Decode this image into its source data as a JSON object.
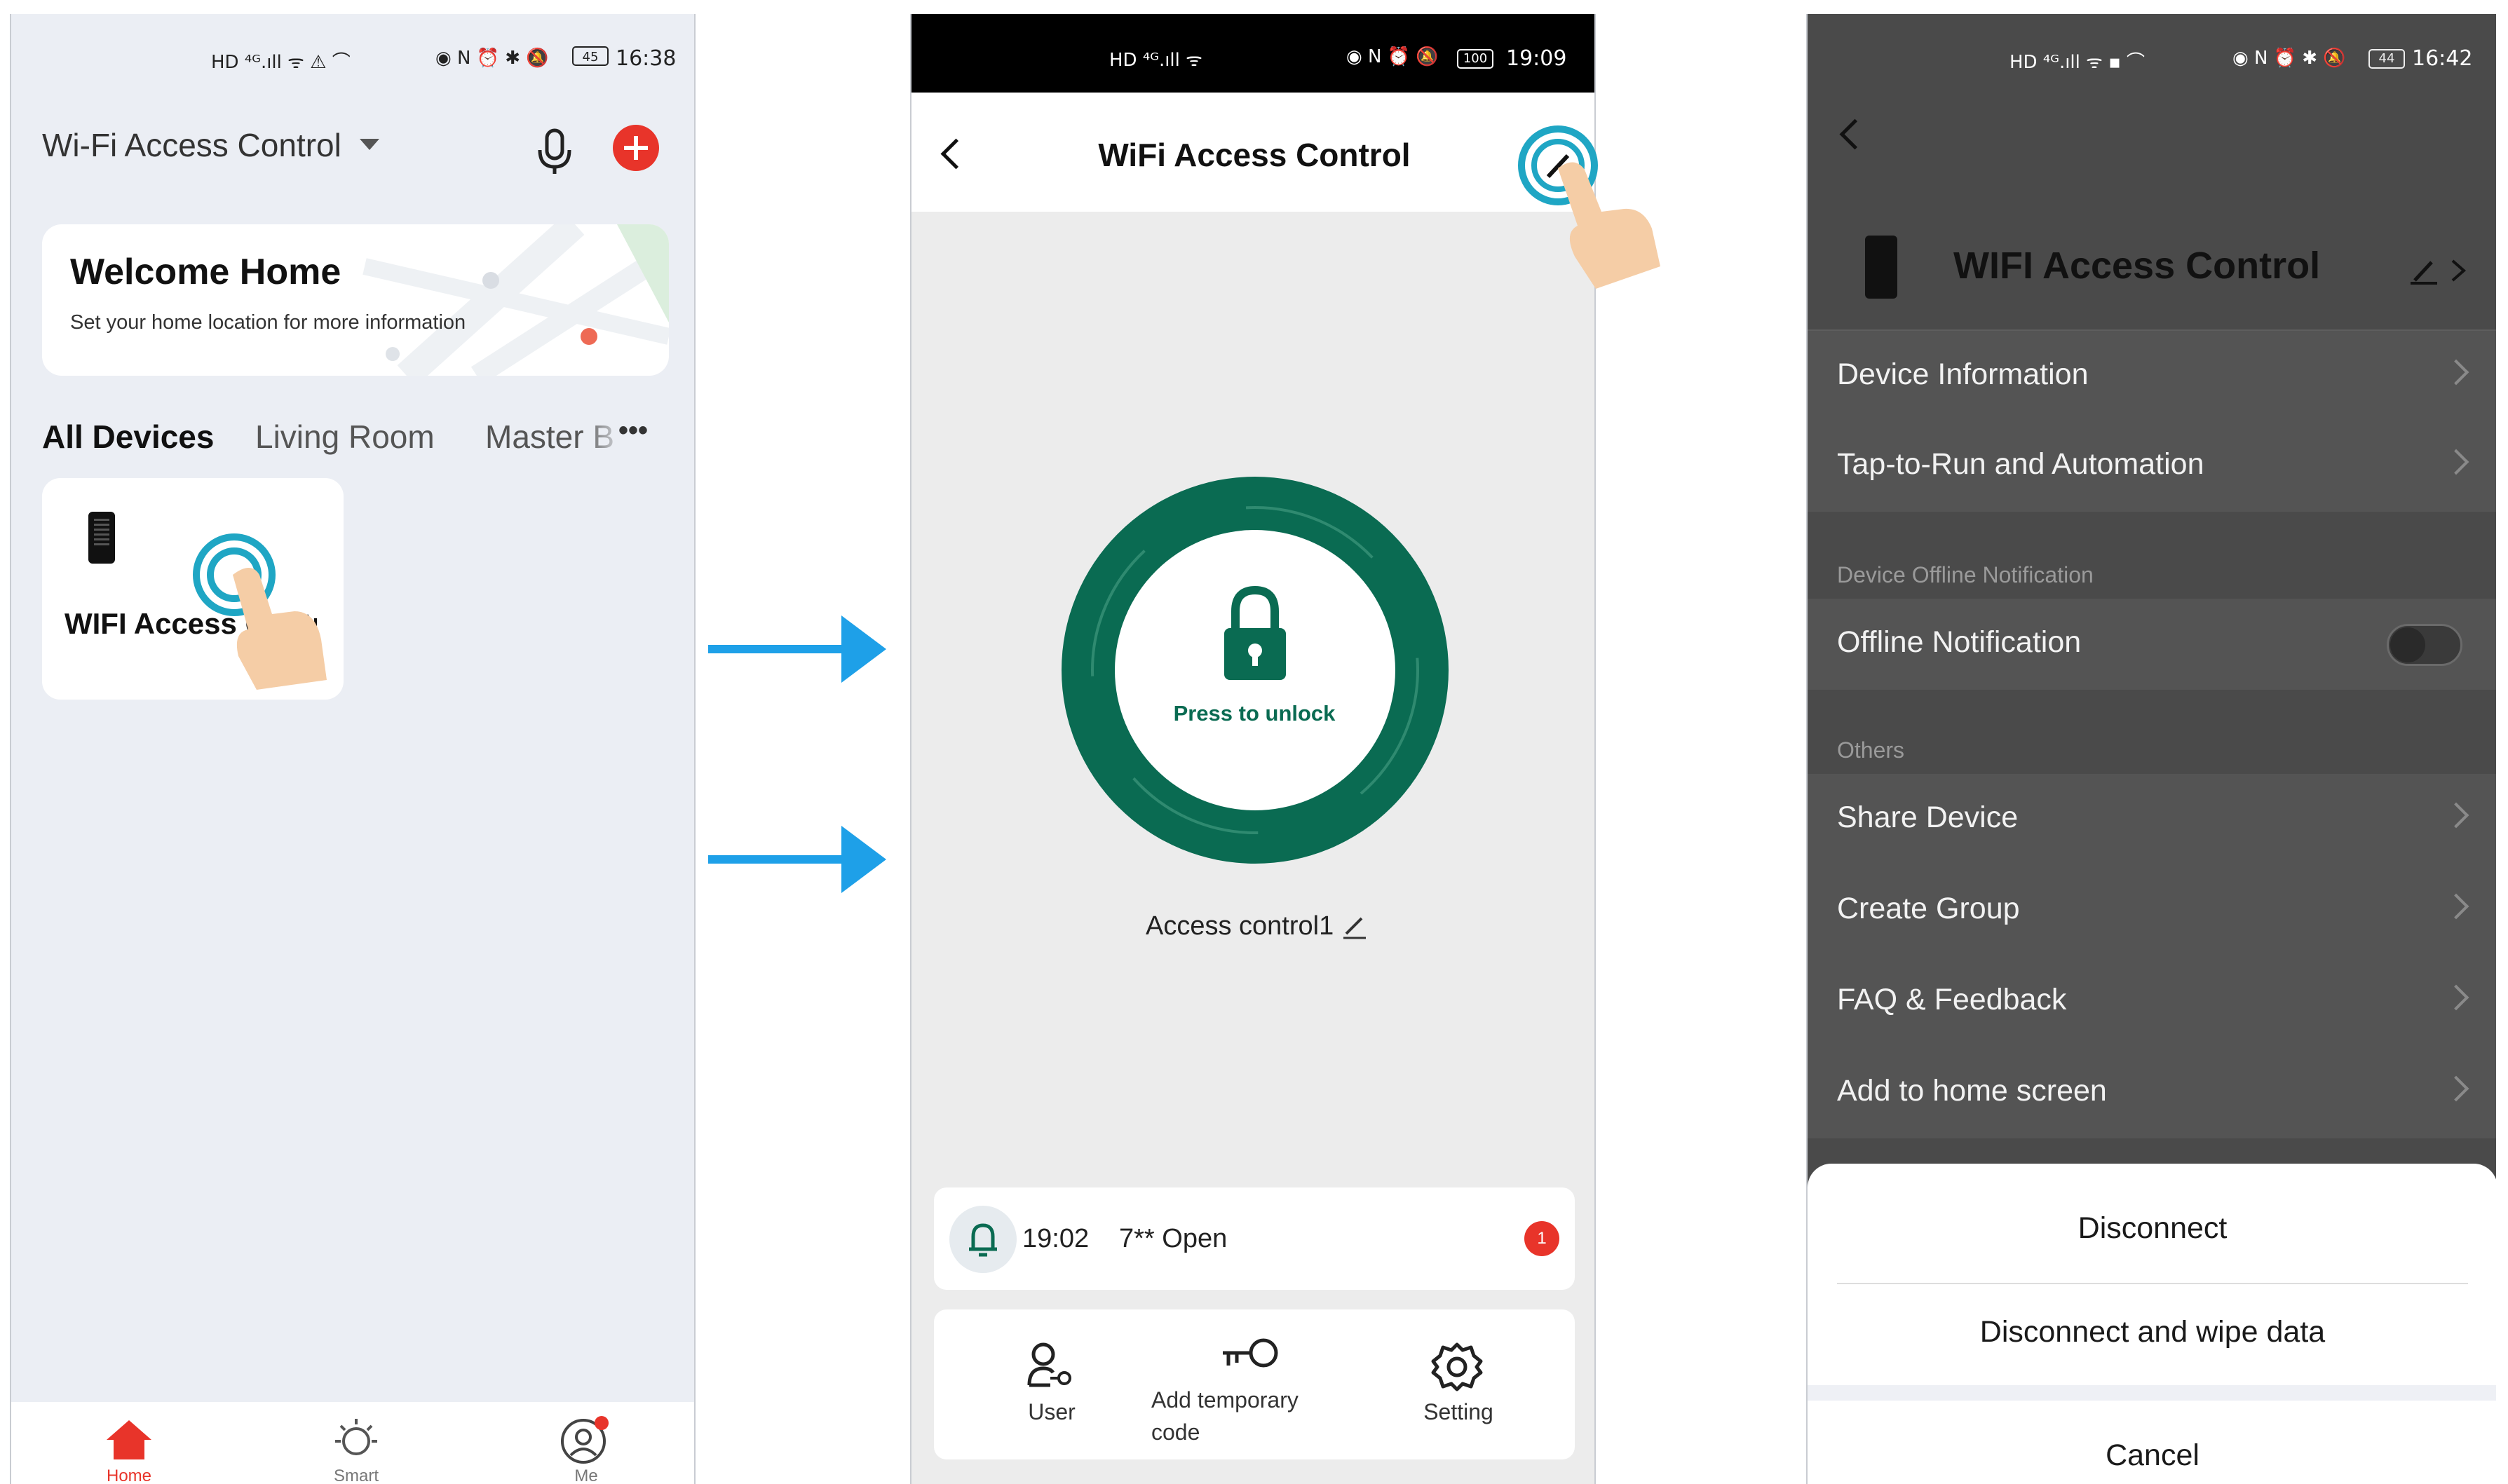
{
  "screen1": {
    "status": {
      "icons": "HD ⁴ᴳ.ıll ᯤ ⚠ ⌒",
      "right_icons": "◉ N ⏰ ✱ 🔕",
      "battery": "45",
      "time": "16:38"
    },
    "home_title": "Wi-Fi Access Control",
    "welcome_title": "Welcome Home",
    "welcome_sub": "Set your home location for more information",
    "tabs": [
      "All Devices",
      "Living Room",
      "Master B"
    ],
    "more": "•••",
    "device_name": "WIFI Access Control",
    "nav": [
      "Home",
      "Smart",
      "Me"
    ]
  },
  "screen2": {
    "status": {
      "icons": "HD ⁴ᴳ.ıll ᯤ",
      "right_icons": "◉ N ⏰ 🔕",
      "battery": "100",
      "time": "19:09"
    },
    "title": "WiFi Access Control",
    "unlock_label": "Press to unlock",
    "device_label": "Access control1",
    "event_time": "19:02",
    "event_text": "7** Open",
    "event_badge": "1",
    "actions": [
      "User",
      "Add temporary code",
      "Setting"
    ]
  },
  "screen3": {
    "status": {
      "icons": "HD ⁴ᴳ.ıll ᯤ ▪ ⌒",
      "right_icons": "◉ N ⏰ ✱ 🔕",
      "battery": "44",
      "time": "16:42"
    },
    "device_title": "WIFI Access Control",
    "rows_top": [
      "Device Information",
      "Tap-to-Run and Automation"
    ],
    "section_offline": "Device Offline Notification",
    "offline_row": "Offline Notification",
    "section_others": "Others",
    "rows_others": [
      "Share Device",
      "Create Group",
      "FAQ & Feedback",
      "Add to home screen"
    ],
    "sheet": [
      "Disconnect",
      "Disconnect and wipe data",
      "Cancel"
    ]
  },
  "colors": {
    "accent_red": "#e8342a",
    "lock_green": "#0a6b52",
    "arrow_blue": "#1ea0e8",
    "tap_cyan": "#1fa6c4"
  }
}
